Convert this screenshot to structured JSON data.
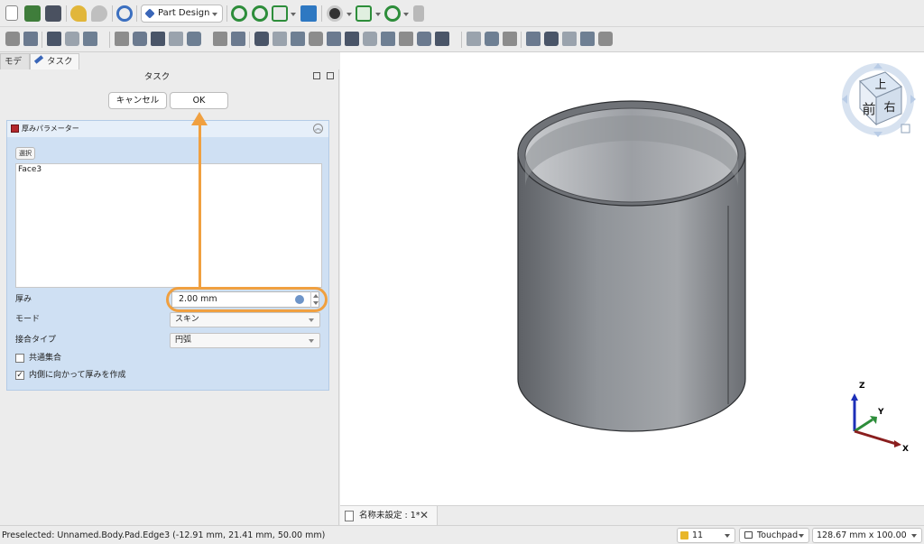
{
  "toolbar": {
    "workbench": "Part Design",
    "row1_icons": [
      "new-file-icon",
      "open-file-icon",
      "save-icon",
      "undo-icon",
      "redo-icon",
      "refresh-icon",
      "zoom-fit-all-icon",
      "zoom-selection-icon",
      "view-cube-menu-icon",
      "bounding-box-icon",
      "draw-style-icon",
      "standard-views-icon",
      "measure-icon",
      "macro-icon"
    ],
    "row2_icons": [
      "part-icon",
      "folder-icon",
      "link-icon",
      "variable-set-icon",
      "body-icon",
      "create-sketch-icon",
      "datum-point-icon",
      "datum-line-icon",
      "datum-plane-icon",
      "local-cs-icon",
      "shape-binder-icon",
      "clone-icon",
      "pad-icon",
      "revolution-icon",
      "loft-icon",
      "pipe-icon",
      "helix-icon",
      "pocket-icon",
      "hole-icon",
      "groove-icon",
      "subtractive-loft-icon",
      "subtractive-pipe-icon",
      "subtractive-helix-icon",
      "fillet-icon",
      "chamfer-icon",
      "draft-icon",
      "thickness-icon",
      "mirrored-icon",
      "linear-pattern-icon",
      "polar-pattern-icon",
      "multi-transform-icon"
    ]
  },
  "tabs": {
    "model": "モデル",
    "task": "タスク"
  },
  "panel": {
    "title": "タスク",
    "cancel_label": "キャンセル",
    "ok_label": "OK",
    "thickness": {
      "title": "厚みパラメーター",
      "select_label": "選択",
      "faces": [
        "Face3"
      ],
      "thickness_label": "厚み",
      "thickness_value": "2.00 mm",
      "mode_label": "モード",
      "mode_value": "スキン",
      "join_label": "接合タイプ",
      "join_value": "円弧",
      "intersection_label": "共通集合",
      "intersection_checked": false,
      "inward_label": "内側に向かって厚みを作成",
      "inward_checked": true
    }
  },
  "view": {
    "navcube": {
      "top": "上",
      "front": "前",
      "right": "右"
    },
    "axes": {
      "x": "X",
      "y": "Y",
      "z": "Z"
    }
  },
  "document": {
    "tab_title": "名称未設定 : 1*"
  },
  "status": {
    "message": "Preselected: Unnamed.Body.Pad.Edge3 (-12.91 mm, 21.41 mm, 50.00 mm)",
    "layer": "11",
    "nav_style": "Touchpad",
    "dimensions": "128.67 mm x 100.00 mm"
  },
  "colors": {
    "highlight": "#f0a040",
    "task_box": "#cfe0f3",
    "cylinder": "#8a8d92"
  }
}
